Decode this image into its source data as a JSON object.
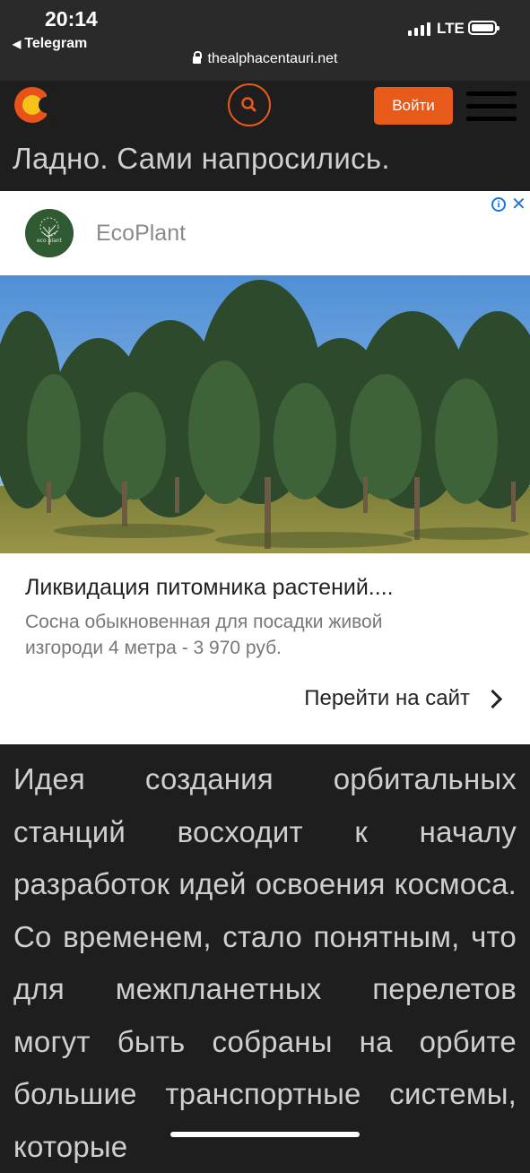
{
  "status_bar": {
    "time": "20:14",
    "back_label": "Telegram",
    "network": "LTE",
    "url": "thealphacentauri.net"
  },
  "header": {
    "login_label": "Войти",
    "accent_color": "#e85a1a"
  },
  "page_title": "Ладно. Сами напросились.",
  "ad": {
    "brand_name": "EcoPlant",
    "headline": "Ликвидация питомника растений....",
    "description": "Сосна обыкновенная для посадки живой изгороди 4 метра - 3 970 руб.",
    "cta_label": "Перейти на сайт"
  },
  "article": {
    "text": "Идея создания орбитальных станций восходит к началу разработок идей освоения космоса. Со временем, стало понятным, что для межпланетных перелетов могут быть собраны на орбите большие транспортные системы, которые"
  },
  "icons": {
    "logo": "site-logo-icon",
    "search": "search-icon",
    "menu": "hamburger-icon",
    "ad_info": "info-icon",
    "ad_close": "close-icon",
    "cta_arrow": "chevron-right-icon"
  }
}
